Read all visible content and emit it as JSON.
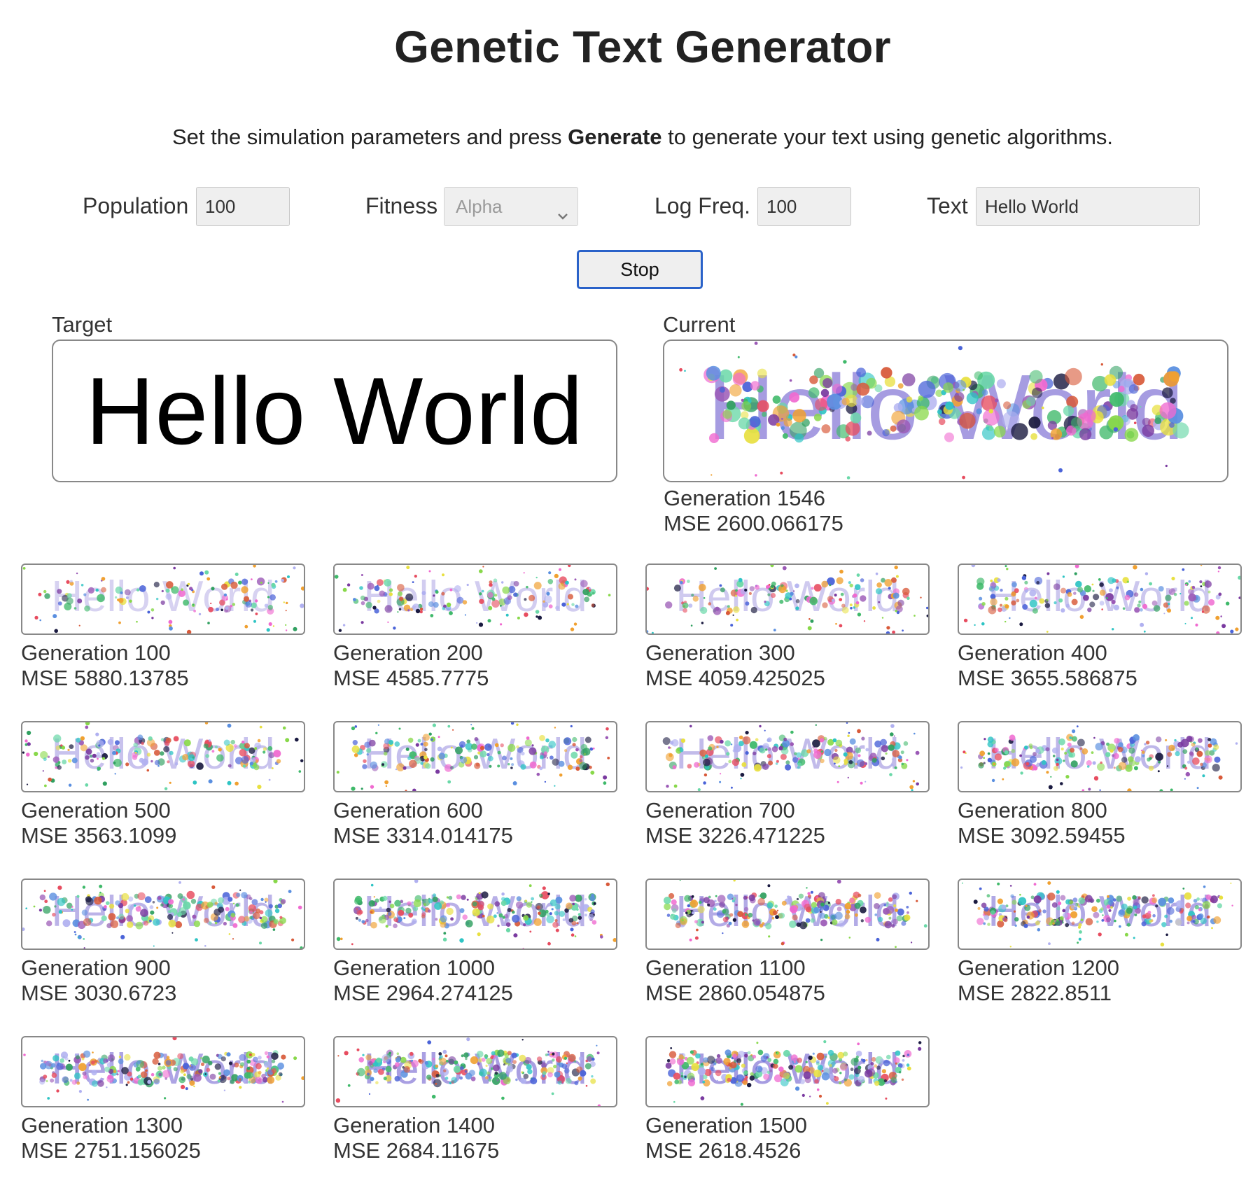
{
  "title": "Genetic Text Generator",
  "intro": {
    "before": "Set the simulation parameters and press ",
    "bold": "Generate",
    "after": " to generate your text using genetic algorithms."
  },
  "controls": {
    "population_label": "Population",
    "population_value": "100",
    "fitness_label": "Fitness",
    "fitness_value": "Alpha",
    "logfreq_label": "Log Freq.",
    "logfreq_value": "100",
    "text_label": "Text",
    "text_value": "Hello World",
    "stop_label": "Stop"
  },
  "target": {
    "label": "Target",
    "text": "Hello World"
  },
  "current": {
    "label": "Current",
    "text": "Hello World",
    "generation": "Generation 1546",
    "mse": "MSE 2600.066175"
  },
  "palette": [
    "#e74c5f",
    "#3fb96a",
    "#4a63d8",
    "#f0a030",
    "#9b59b6",
    "#2ec4c4",
    "#f06ad0",
    "#1a1a40",
    "#88d84a",
    "#e8e040",
    "#5a8fe0",
    "#d85a3a",
    "#6ad8a8",
    "#b0b0f0",
    "#7a3aa0",
    "#30a060"
  ],
  "generations": [
    {
      "generation": "Generation 100",
      "mse": "MSE 5880.13785"
    },
    {
      "generation": "Generation 200",
      "mse": "MSE 4585.7775"
    },
    {
      "generation": "Generation 300",
      "mse": "MSE 4059.425025"
    },
    {
      "generation": "Generation 400",
      "mse": "MSE 3655.586875"
    },
    {
      "generation": "Generation 500",
      "mse": "MSE 3563.1099"
    },
    {
      "generation": "Generation 600",
      "mse": "MSE 3314.014175"
    },
    {
      "generation": "Generation 700",
      "mse": "MSE 3226.471225"
    },
    {
      "generation": "Generation 800",
      "mse": "MSE 3092.59455"
    },
    {
      "generation": "Generation 900",
      "mse": "MSE 3030.6723"
    },
    {
      "generation": "Generation 1000",
      "mse": "MSE 2964.274125"
    },
    {
      "generation": "Generation 1100",
      "mse": "MSE 2860.054875"
    },
    {
      "generation": "Generation 1200",
      "mse": "MSE 2822.8511"
    },
    {
      "generation": "Generation 1300",
      "mse": "MSE 2751.156025"
    },
    {
      "generation": "Generation 1400",
      "mse": "MSE 2684.11675"
    },
    {
      "generation": "Generation 1500",
      "mse": "MSE 2618.4526"
    }
  ]
}
